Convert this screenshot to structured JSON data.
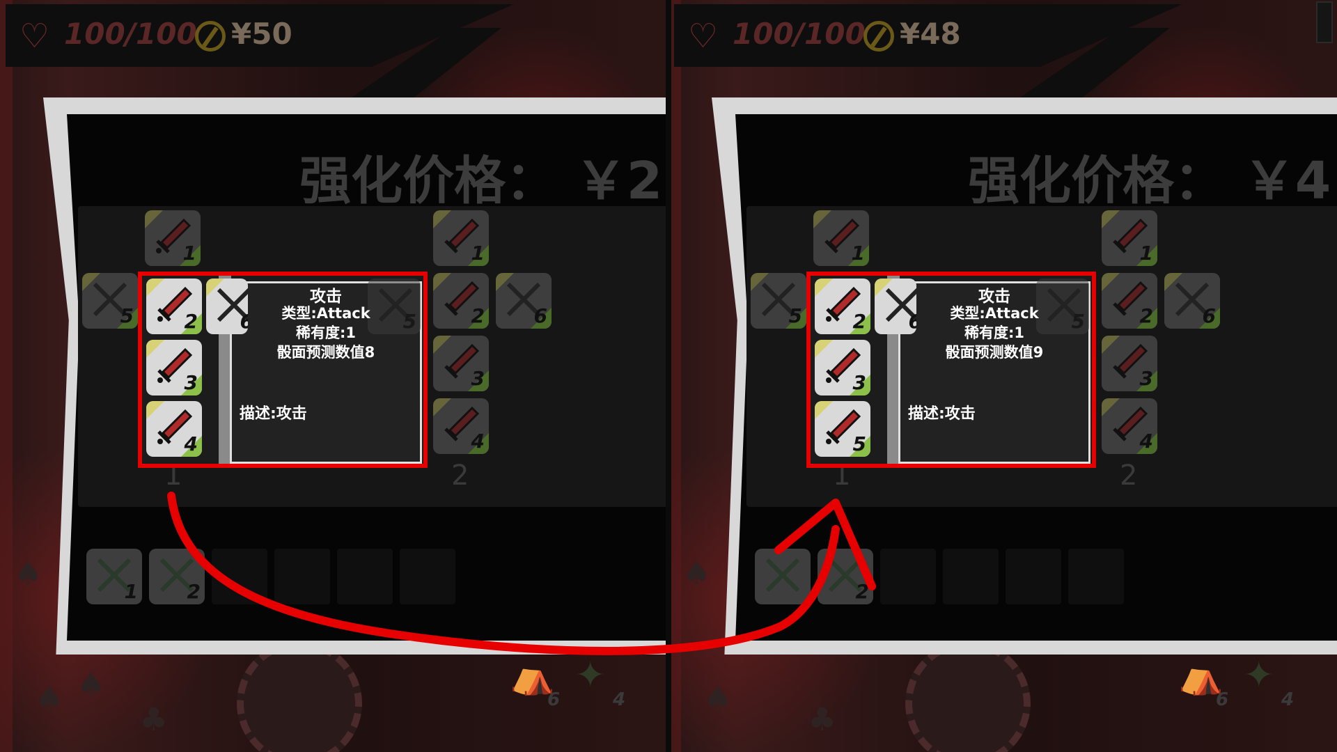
{
  "panels": [
    {
      "hp": "100/100",
      "money": "¥50",
      "price_title": "强化价格： ￥2",
      "column_labels": [
        "1",
        "2"
      ],
      "tooltip": {
        "title": "攻击",
        "type": "类型:Attack",
        "rarity": "稀有度:1",
        "predict": "骰面预测数值8",
        "desc": "描述:攻击"
      },
      "dice_left_col": [
        "2",
        "3",
        "4"
      ],
      "dice_top": "1",
      "dice_side": "5",
      "dice_mid": "6",
      "dice_col2": [
        "1",
        "2",
        "3",
        "4"
      ],
      "dice_col2_side": "6",
      "dice_behind_tip": "5",
      "tray_items": [
        "1",
        "2"
      ],
      "bottom_items": [
        "6",
        "4"
      ]
    },
    {
      "hp": "100/100",
      "money": "¥48",
      "price_title": "强化价格： ￥4",
      "column_labels": [
        "1",
        "2"
      ],
      "tooltip": {
        "title": "攻击",
        "type": "类型:Attack",
        "rarity": "稀有度:1",
        "predict": "骰面预测数值9",
        "desc": "描述:攻击"
      },
      "dice_left_col": [
        "2",
        "3",
        "5"
      ],
      "dice_top": "1",
      "dice_side": "5",
      "dice_mid": "6",
      "dice_col2": [
        "1",
        "2",
        "3",
        "4"
      ],
      "dice_col2_side": "6",
      "dice_behind_tip": "5",
      "tray_items": [
        "",
        "2"
      ],
      "bottom_items": [
        "6",
        "4"
      ]
    }
  ],
  "colors": {
    "highlight": "#e60000",
    "dialog_bg": "#050505",
    "hp_icon": "#6e2a2a",
    "coin": "#6b5a17"
  },
  "icons": {
    "hp": "heart-icon",
    "money": "coin-icon",
    "die_face": "sword-icon",
    "spade": "spade-icon",
    "club": "club-icon"
  }
}
